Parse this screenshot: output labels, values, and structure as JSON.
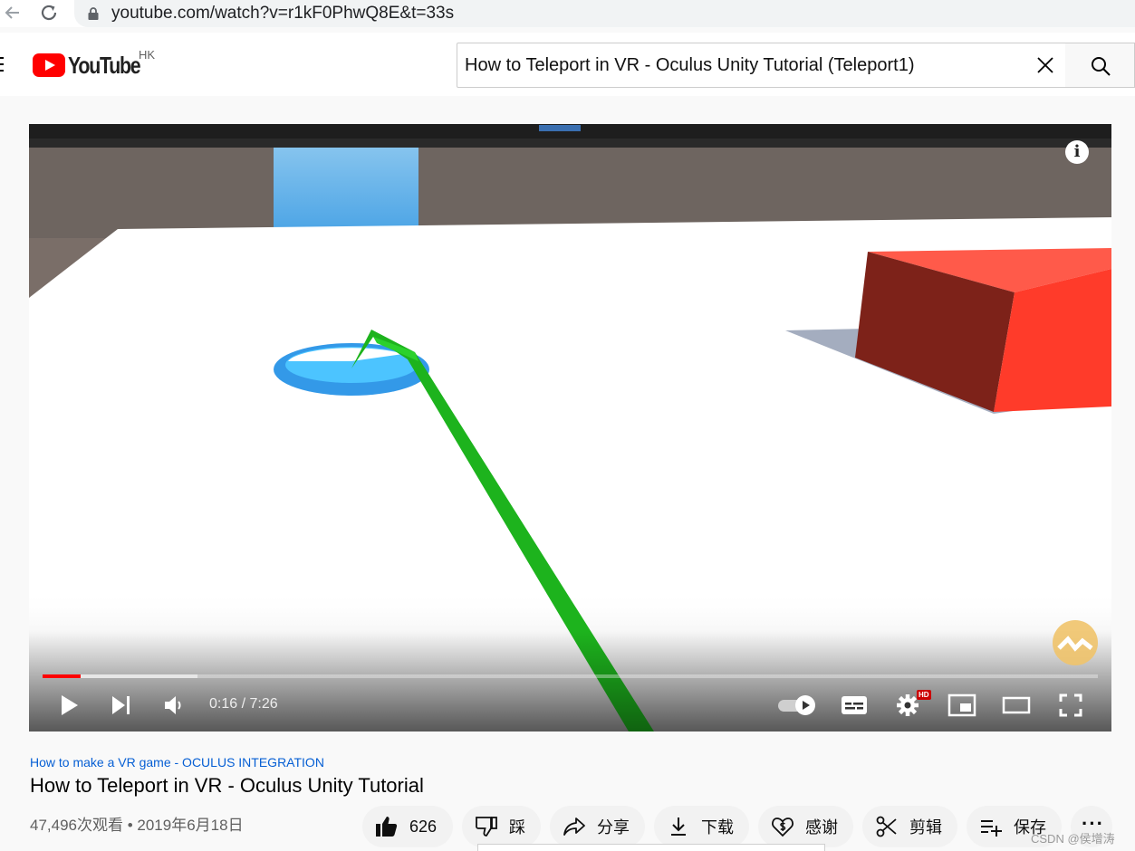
{
  "browser": {
    "url": "youtube.com/watch?v=r1kF0PhwQ8E&t=33s"
  },
  "header": {
    "logo_text": "YouTube",
    "region": "HK",
    "search_value": "How to Teleport in VR - Oculus Unity Tutorial (Teleport1)"
  },
  "player": {
    "current_time": "0:16",
    "duration": "7:26",
    "time_display": "0:16 / 7:26",
    "played_fraction": 0.036,
    "buffered_fraction": 0.147,
    "hd_badge": "HD",
    "info_label": "i"
  },
  "video": {
    "playlist": "How to make a VR game - OCULUS INTEGRATION",
    "title": "How to Teleport in VR - Oculus Unity Tutorial",
    "meta": "47,496次观看 • 2019年6月18日"
  },
  "actions": {
    "like_count": "626",
    "dislike_label": "踩",
    "share_label": "分享",
    "download_label": "下载",
    "thanks_label": "感谢",
    "clip_label": "剪辑",
    "save_label": "保存"
  },
  "overlay": {
    "csdn_watermark": "CSDN @侯增涛"
  },
  "colors": {
    "brand_red": "#ff0000",
    "link_blue": "#065fd4",
    "laser_green": "#1db31d",
    "teleport_blue": "#2aa8f0",
    "cube_red": "#ff3b2a"
  }
}
